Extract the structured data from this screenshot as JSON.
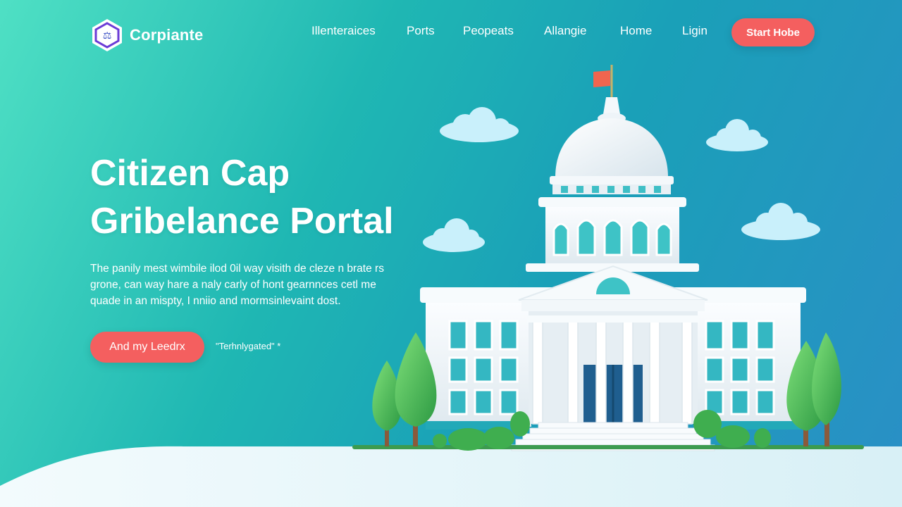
{
  "brand": {
    "name": "Corpiante",
    "logo_glyph": "⚖"
  },
  "nav": {
    "links": [
      "Illenteraices",
      "Ports",
      "Peopeats",
      "Allangie",
      "Home",
      "Ligin"
    ],
    "cta_label": "Start Hobe"
  },
  "hero": {
    "title_line1": "Citizen Cap",
    "title_line2": "Gribelance Portal",
    "description_line1": "The panily mest wimbile ilod 0il way visith de cleze n brate rs",
    "description_line2": "grone, can way hare a naly carly of hont gearnnces cetl me",
    "description_line3": "quade in an mispty, I nniio and mormsinlevaint dost.",
    "primary_button": "And my Leedrx",
    "secondary_link": "\"Terhnlygated\" *"
  },
  "colors": {
    "accent": "#f45f5f",
    "bg_start": "#4fe0c4",
    "bg_end": "#2a8fc6",
    "ground": "#e6f6fa"
  },
  "icons": {
    "logo": "hexagon-logo-icon",
    "illustration": "capitol-building-illustration"
  }
}
